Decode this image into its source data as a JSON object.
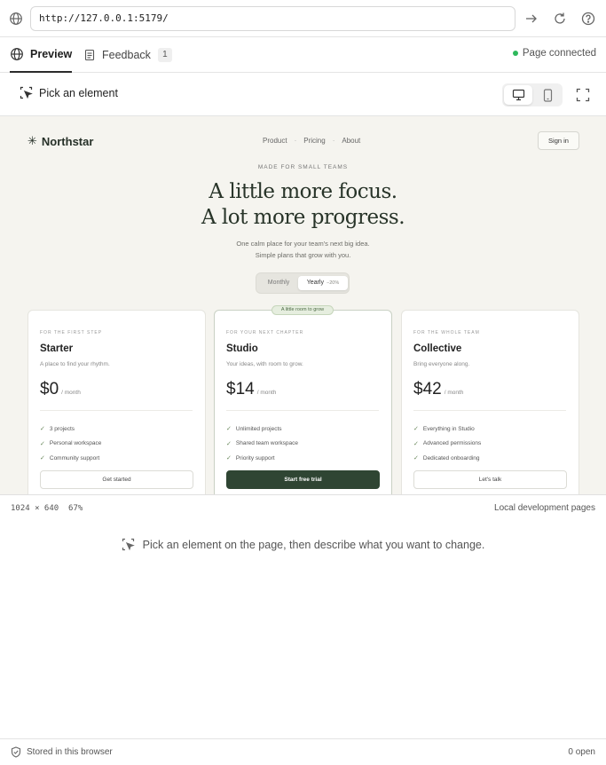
{
  "url_bar": {
    "url": "http://127.0.0.1:5179/"
  },
  "tabs": [
    {
      "label": "Preview",
      "active": true
    },
    {
      "label": "Feedback",
      "count": "1"
    }
  ],
  "connection": {
    "status": "Page connected",
    "color": "#2eb85c"
  },
  "toolbar": {
    "pick_label": "Pick an element"
  },
  "preview": {
    "brand": "Northstar",
    "brand_mark": "✳",
    "nav": [
      "Product",
      "Pricing",
      "About"
    ],
    "nav_separator": "·",
    "signin": "Sign in",
    "eyebrow": "MADE FOR SMALL TEAMS",
    "headline_1": "A little more focus.",
    "headline_2": "A lot more progress.",
    "sub_1": "One calm place for your team's next big idea.",
    "sub_2": "Simple plans that grow with you.",
    "billing": {
      "monthly": "Monthly",
      "yearly": "Yearly",
      "discount": "−20%"
    },
    "ribbon": "A little room to grow",
    "plans": [
      {
        "kicker": "FOR THE FIRST STEP",
        "name": "Starter",
        "desc": "A place to find your rhythm.",
        "price": "$0",
        "per": "/ month",
        "features": [
          "3 projects",
          "Personal workspace",
          "Community support"
        ],
        "cta": "Get started"
      },
      {
        "kicker": "FOR YOUR NEXT CHAPTER",
        "name": "Studio",
        "desc": "Your ideas, with room to grow.",
        "price": "$14",
        "per": "/ month",
        "features": [
          "Unlimited projects",
          "Shared team workspace",
          "Priority support"
        ],
        "cta": "Start free trial"
      },
      {
        "kicker": "FOR THE WHOLE TEAM",
        "name": "Collective",
        "desc": "Bring everyone along.",
        "price": "$42",
        "per": "/ month",
        "features": [
          "Everything in Studio",
          "Advanced permissions",
          "Dedicated onboarding"
        ],
        "cta": "Let's talk"
      }
    ],
    "check_glyph": "✓",
    "accent": "#2f4533",
    "background": "#f5f4ef"
  },
  "status_bar": {
    "dims": "1024 × 640",
    "zoom": "67%",
    "source": "Local development pages"
  },
  "hint": "Pick an element on the page, then describe what you want to change.",
  "footer": {
    "stored": "Stored in this browser",
    "open": "0 open"
  }
}
